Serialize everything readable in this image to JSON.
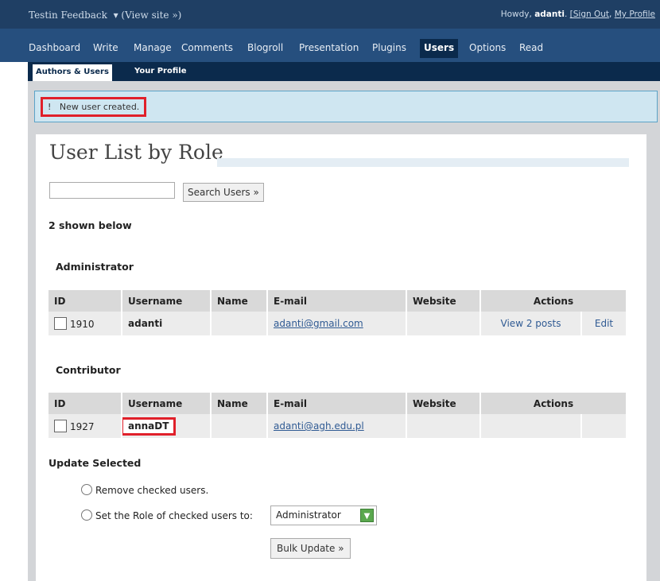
{
  "header": {
    "site_title": "Testin Feedback",
    "view_site": "(View site »)",
    "howdy_prefix": "Howdy,",
    "username": "adanti",
    "sign_out": "[Sign Out",
    "separator": ",",
    "my_profile": "My Profile"
  },
  "menu": {
    "items": [
      "Dashboard",
      "Write",
      "Manage",
      "Comments",
      "Blogroll",
      "Presentation",
      "Plugins",
      "Users",
      "Options",
      "Read"
    ],
    "active": "Users"
  },
  "submenu": {
    "items": [
      "Authors & Users",
      "Your Profile"
    ],
    "active": "Authors & Users"
  },
  "notice": {
    "icon": "!",
    "message": "New user created."
  },
  "page": {
    "title": "User List by Role",
    "search_placeholder": "",
    "search_button": "Search Users »",
    "shown_text": "2 shown below"
  },
  "columns": [
    "ID",
    "Username",
    "Name",
    "E-mail",
    "Website",
    "Actions"
  ],
  "roles": [
    {
      "name": "Administrator",
      "users": [
        {
          "id": "1910",
          "username": "adanti",
          "name": "",
          "email": "adanti@gmail.com",
          "website": "",
          "view_posts": "View 2 posts",
          "edit": "Edit"
        }
      ]
    },
    {
      "name": "Contributor",
      "users": [
        {
          "id": "1927",
          "username": "annaDT",
          "name": "",
          "email": "adanti@agh.edu.pl",
          "website": "",
          "view_posts": "",
          "edit": ""
        }
      ]
    }
  ],
  "update": {
    "heading": "Update Selected",
    "option_remove": "Remove checked users.",
    "option_set_role": "Set the Role of checked users to:",
    "role_selected": "Administrator",
    "bulk_button": "Bulk Update »"
  },
  "colors": {
    "topbar": "#1f3f64",
    "menu": "#264f7e",
    "submenu": "#0b2a4c",
    "highlight": "#e0202a",
    "link": "#2f5a93"
  }
}
